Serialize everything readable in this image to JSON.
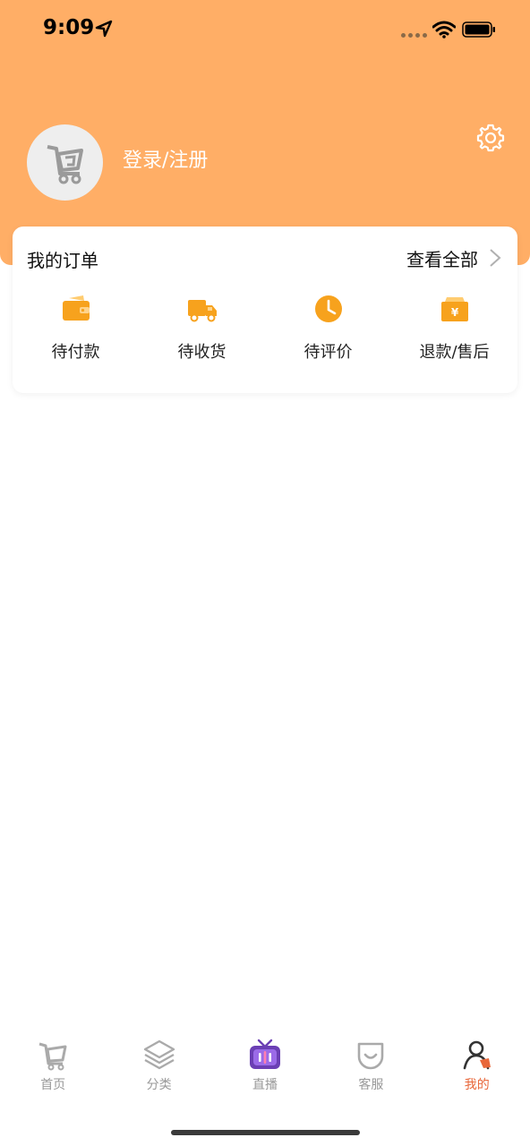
{
  "status_bar": {
    "time": "9:09",
    "icons": [
      "location-arrow-icon",
      "signal-dots-icon",
      "wifi-icon",
      "battery-icon"
    ]
  },
  "header": {
    "login_label": "登录/注册",
    "background_color": "#ffae66",
    "icons": [
      "avatar-logo-icon",
      "gear-icon"
    ]
  },
  "orders": {
    "title": "我的订单",
    "view_all_label": "查看全部",
    "items": [
      {
        "label": "待付款",
        "icon": "wallet-icon"
      },
      {
        "label": "待收货",
        "icon": "truck-icon"
      },
      {
        "label": "待评价",
        "icon": "clock-icon"
      },
      {
        "label": "退款/售后",
        "icon": "refund-yen-icon"
      }
    ],
    "accent_color": "#f7a21d"
  },
  "tab_bar": {
    "active_color": "#e8673a",
    "inactive_color": "#999999",
    "tabs": [
      {
        "label": "首页",
        "icon": "home-logo-icon",
        "active": false
      },
      {
        "label": "分类",
        "icon": "layers-icon",
        "active": false
      },
      {
        "label": "直播",
        "icon": "tv-live-icon",
        "active": false
      },
      {
        "label": "客服",
        "icon": "smile-service-icon",
        "active": false
      },
      {
        "label": "我的",
        "icon": "user-icon",
        "active": true
      }
    ]
  }
}
